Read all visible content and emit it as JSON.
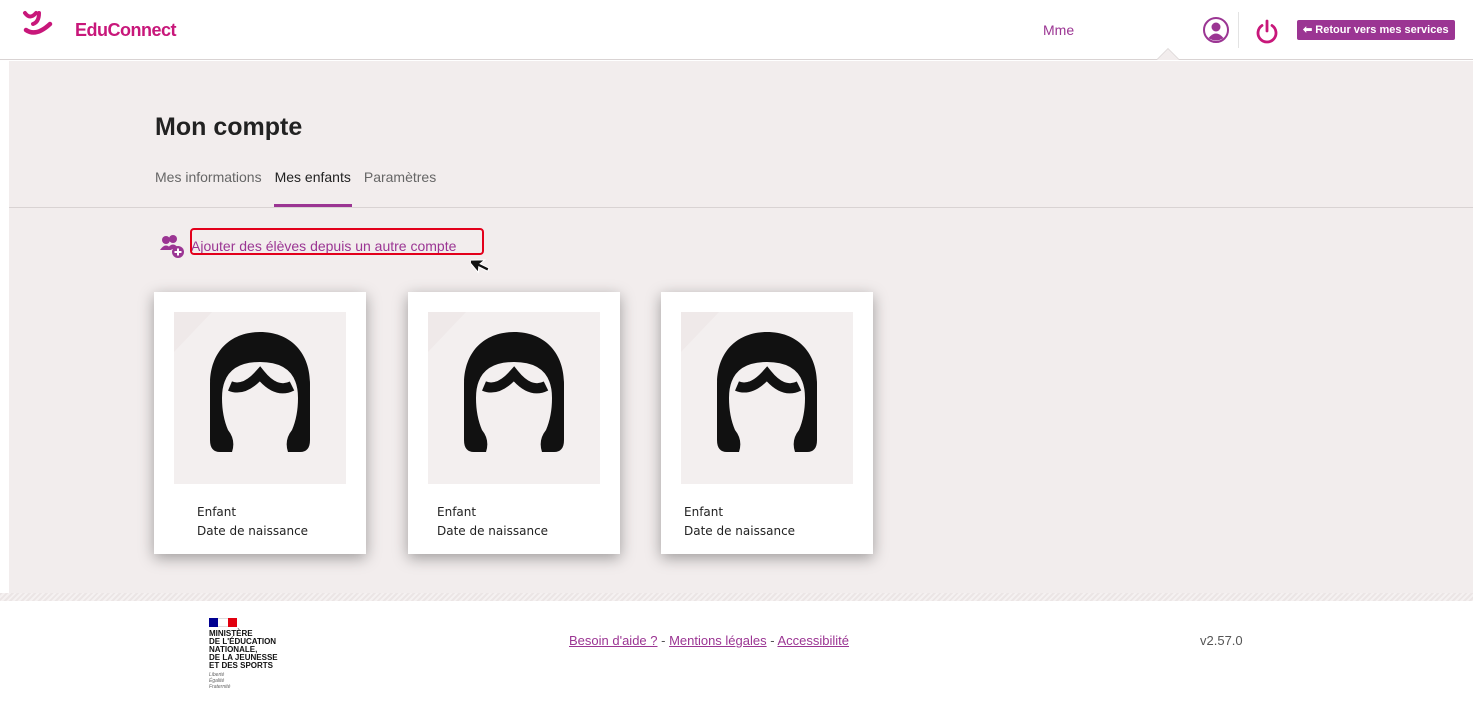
{
  "header": {
    "brand": "EduConnect",
    "user_name": "Mme",
    "back_button": "Retour vers mes services"
  },
  "page": {
    "title": "Mon compte",
    "tabs": [
      {
        "label": "Mes informations",
        "active": false
      },
      {
        "label": "Mes enfants",
        "active": true
      },
      {
        "label": "Paramètres",
        "active": false
      }
    ],
    "add_link": "Ajouter des élèves depuis un autre compte"
  },
  "children": [
    {
      "name": "Enfant",
      "dob": "Date de naissance"
    },
    {
      "name": "Enfant",
      "dob": "Date de naissance"
    },
    {
      "name": "Enfant",
      "dob": "Date de naissance"
    }
  ],
  "footer": {
    "ministry_lines": "MINISTÈRE\nDE L'ÉDUCATION\nNATIONALE,\nDE LA JEUNESSE\nET DES SPORTS",
    "motto": "Liberté\nÉgalité\nFraternité",
    "help": "Besoin d'aide ?",
    "legal": "Mentions légales",
    "accessibility": "Accessibilité",
    "separator": " - ",
    "version": "v2.57.0"
  },
  "colors": {
    "brand": "#c8177a",
    "accent": "#9b3593",
    "highlight": "#e3001b",
    "panel": "#f2eded"
  },
  "icons": {
    "logo": "educonnect-logo-icon",
    "profile": "profile-icon",
    "power": "power-icon",
    "back": "arrow-left-icon",
    "add": "add-students-icon",
    "avatar": "child-avatar-icon",
    "cursor": "mouse-cursor-icon"
  }
}
